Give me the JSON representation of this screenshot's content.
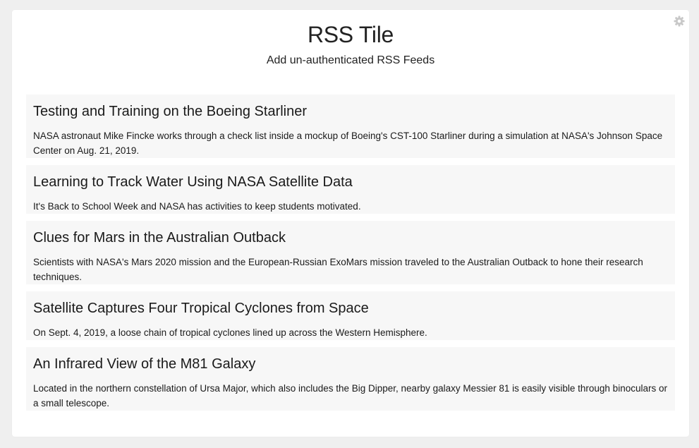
{
  "tile": {
    "title": "RSS Tile",
    "subtitle": "Add un-authenticated RSS Feeds",
    "settings_icon": "gear-icon"
  },
  "feed": {
    "items": [
      {
        "title": "Testing and Training on the Boeing Starliner",
        "description": "NASA astronaut Mike Fincke works through a check list inside a mockup of Boeing's CST-100 Starliner during a simulation at NASA's Johnson Space Center on Aug. 21, 2019."
      },
      {
        "title": "Learning to Track Water Using NASA Satellite Data",
        "description": "It's Back to School Week and NASA has activities to keep students motivated."
      },
      {
        "title": "Clues for Mars in the Australian Outback",
        "description": "Scientists with NASA's Mars 2020 mission and the European-Russian ExoMars mission traveled to the Australian Outback to hone their research techniques."
      },
      {
        "title": "Satellite Captures Four Tropical Cyclones from Space",
        "description": "On Sept. 4, 2019, a loose chain of tropical cyclones lined up across the Western Hemisphere."
      },
      {
        "title": "An Infrared View of the M81 Galaxy",
        "description": "Located in the northern constellation of Ursa Major, which also includes the Big Dipper, nearby galaxy Messier 81 is easily visible through binoculars or a small telescope."
      }
    ]
  },
  "colors": {
    "page_background": "#efefef",
    "tile_background": "#ffffff",
    "item_background": "#f7f7f7",
    "icon_color": "#c8c8c8"
  }
}
